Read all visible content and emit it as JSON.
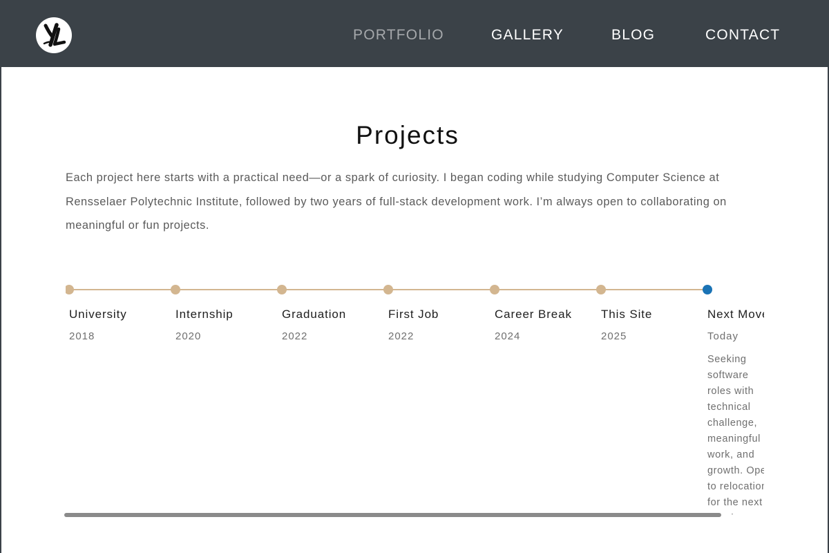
{
  "logo": {
    "text": "YL"
  },
  "nav": [
    {
      "label": "PORTFOLIO",
      "active": true
    },
    {
      "label": "GALLERY",
      "active": false
    },
    {
      "label": "BLOG",
      "active": false
    },
    {
      "label": "CONTACT",
      "active": false
    }
  ],
  "page": {
    "title": "Projects",
    "intro": "Each project here starts with a practical need—or a spark of curiosity. I began coding while studying Computer Science at Rensselaer Polytechnic Institute, followed by two years of full-stack development work. I’m always open to collaborating on meaningful or fun projects."
  },
  "timeline": {
    "milestones": [
      {
        "label": "University",
        "date": "2018",
        "current": false,
        "description": ""
      },
      {
        "label": "Internship",
        "date": "2020",
        "current": false,
        "description": ""
      },
      {
        "label": "Graduation",
        "date": "2022",
        "current": false,
        "description": ""
      },
      {
        "label": "First Job",
        "date": "2022",
        "current": false,
        "description": ""
      },
      {
        "label": "Career Break",
        "date": "2024",
        "current": false,
        "description": ""
      },
      {
        "label": "This Site",
        "date": "2025",
        "current": false,
        "description": ""
      },
      {
        "label": "Next Move",
        "date": "Today",
        "current": true,
        "description": "Seeking software roles with technical challenge, meaningful work, and growth. Open to relocation for the next step in my journey."
      }
    ]
  },
  "colors": {
    "header_bg": "#3b4248",
    "timeline_line": "#d3b690",
    "current_dot": "#1a73b5",
    "nav_active": "#a5a8ab"
  },
  "icons": {
    "logo": "yl-monogram-logo"
  }
}
